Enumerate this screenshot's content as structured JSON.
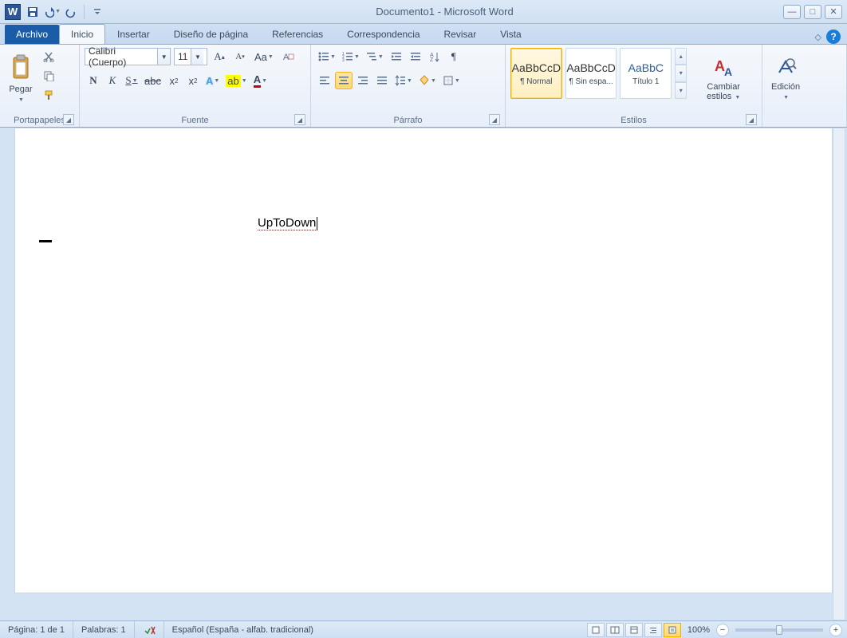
{
  "title": "Documento1 - Microsoft Word",
  "tabs": {
    "file": "Archivo",
    "home": "Inicio",
    "insert": "Insertar",
    "layout": "Diseño de página",
    "references": "Referencias",
    "mail": "Correspondencia",
    "review": "Revisar",
    "view": "Vista"
  },
  "ribbon": {
    "clipboard": {
      "label": "Portapapeles",
      "paste": "Pegar"
    },
    "font": {
      "label": "Fuente",
      "family": "Calibri (Cuerpo)",
      "size": "11"
    },
    "paragraph": {
      "label": "Párrafo"
    },
    "styles": {
      "label": "Estilos",
      "preview": "AaBbCcD",
      "preview2": "AaBbCcD",
      "preview3": "AaBbC",
      "normal": "¶ Normal",
      "nospacing": "¶ Sin espa...",
      "heading1": "Título 1",
      "change": "Cambiar estilos"
    },
    "editing": {
      "label": "Edición"
    }
  },
  "document": {
    "text": "UpToDown"
  },
  "status": {
    "page": "Página: 1 de 1",
    "words": "Palabras: 1",
    "language": "Español (España - alfab. tradicional)",
    "zoom": "100%"
  }
}
